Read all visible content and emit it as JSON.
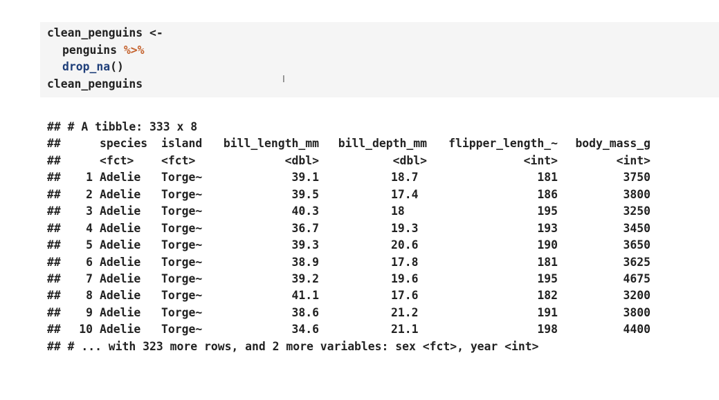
{
  "code": {
    "line1": "clean_penguins <-",
    "line2_var": "penguins",
    "line2_pipe": "%>%",
    "line3_fn": "drop_na",
    "line3_parens": "()",
    "line4": "clean_penguins"
  },
  "cursor_glyph": "I",
  "output": {
    "prefix": "##",
    "header_line": "## # A tibble: 333 x 8",
    "columns": [
      "species",
      "island",
      "bill_length_mm",
      "bill_depth_mm",
      "flipper_length_~",
      "body_mass_g"
    ],
    "types": [
      "<fct>",
      "<fct>",
      "<dbl>",
      "<dbl>",
      "<int>",
      "<int>"
    ],
    "rows": [
      {
        "n": "1",
        "species": "Adelie",
        "island": "Torge~",
        "bill_length": "39.1",
        "bill_depth": "18.7",
        "flipper": "181",
        "mass": "3750"
      },
      {
        "n": "2",
        "species": "Adelie",
        "island": "Torge~",
        "bill_length": "39.5",
        "bill_depth": "17.4",
        "flipper": "186",
        "mass": "3800"
      },
      {
        "n": "3",
        "species": "Adelie",
        "island": "Torge~",
        "bill_length": "40.3",
        "bill_depth": "18",
        "flipper": "195",
        "mass": "3250"
      },
      {
        "n": "4",
        "species": "Adelie",
        "island": "Torge~",
        "bill_length": "36.7",
        "bill_depth": "19.3",
        "flipper": "193",
        "mass": "3450"
      },
      {
        "n": "5",
        "species": "Adelie",
        "island": "Torge~",
        "bill_length": "39.3",
        "bill_depth": "20.6",
        "flipper": "190",
        "mass": "3650"
      },
      {
        "n": "6",
        "species": "Adelie",
        "island": "Torge~",
        "bill_length": "38.9",
        "bill_depth": "17.8",
        "flipper": "181",
        "mass": "3625"
      },
      {
        "n": "7",
        "species": "Adelie",
        "island": "Torge~",
        "bill_length": "39.2",
        "bill_depth": "19.6",
        "flipper": "195",
        "mass": "4675"
      },
      {
        "n": "8",
        "species": "Adelie",
        "island": "Torge~",
        "bill_length": "41.1",
        "bill_depth": "17.6",
        "flipper": "182",
        "mass": "3200"
      },
      {
        "n": "9",
        "species": "Adelie",
        "island": "Torge~",
        "bill_length": "38.6",
        "bill_depth": "21.2",
        "flipper": "191",
        "mass": "3800"
      },
      {
        "n": "10",
        "species": "Adelie",
        "island": "Torge~",
        "bill_length": "34.6",
        "bill_depth": "21.1",
        "flipper": "198",
        "mass": "4400"
      }
    ],
    "footer_line": "## # ... with 323 more rows, and 2 more variables: sex <fct>, year <int>"
  },
  "colors": {
    "pipe_operator": "#c4622d",
    "function_name": "#1f3f7a",
    "code_background": "#f5f5f5"
  }
}
